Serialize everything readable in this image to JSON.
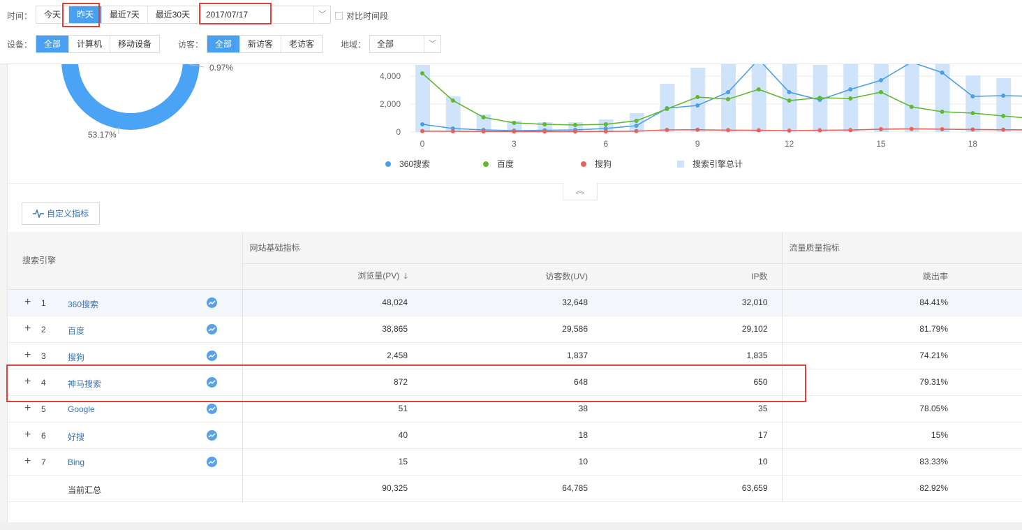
{
  "filters": {
    "time_label": "时间：",
    "time_options": [
      "今天",
      "昨天",
      "最近7天",
      "最近30天"
    ],
    "date_value": "2017/07/17",
    "compare_label": "对比时间段",
    "device_label": "设备：",
    "device_options": [
      "全部",
      "计算机",
      "移动设备"
    ],
    "visitor_label": "访客：",
    "visitor_options": [
      "全部",
      "新访客",
      "老访客"
    ],
    "region_label": "地域：",
    "region_value": "全部"
  },
  "donut": {
    "label_small": "0.97%",
    "label_big": "53.17%",
    "color": "#4aa3f5"
  },
  "chart_data": {
    "type": "bar+line",
    "x": [
      0,
      1,
      2,
      3,
      4,
      5,
      6,
      7,
      8,
      9,
      10,
      11,
      12,
      13,
      14,
      15,
      16,
      17,
      18,
      19,
      20
    ],
    "x_ticks": [
      "0",
      "3",
      "6",
      "9",
      "12",
      "15",
      "18"
    ],
    "y_ticks": [
      "0",
      "2,000",
      "4,000"
    ],
    "ylim": [
      0,
      4900
    ],
    "series": [
      {
        "name": "360搜索",
        "type": "line",
        "color": "#4a9fe6",
        "values": [
          550,
          250,
          150,
          100,
          120,
          150,
          250,
          450,
          1700,
          1900,
          2850,
          6000,
          2850,
          2300,
          3050,
          3700,
          5000,
          4250,
          2550,
          2600,
          2550
        ]
      },
      {
        "name": "百度",
        "type": "line",
        "color": "#61b82e",
        "values": [
          4200,
          2250,
          1050,
          650,
          550,
          500,
          550,
          800,
          1650,
          2500,
          2350,
          3050,
          2250,
          2450,
          2400,
          2850,
          1800,
          1450,
          1350,
          1150,
          950
        ]
      },
      {
        "name": "搜狗",
        "type": "line",
        "color": "#e8625a",
        "values": [
          60,
          50,
          40,
          30,
          30,
          30,
          40,
          60,
          150,
          160,
          130,
          120,
          100,
          120,
          140,
          200,
          220,
          200,
          180,
          160,
          150
        ]
      },
      {
        "name": "搜索引擎总计",
        "type": "bar",
        "color": "#cfe4fa",
        "values": [
          4800,
          2550,
          1250,
          800,
          700,
          700,
          900,
          1350,
          3450,
          4600,
          6000,
          6000,
          6000,
          4800,
          6000,
          6000,
          6000,
          6000,
          4050,
          3850,
          3500
        ]
      }
    ]
  },
  "legend": [
    "360搜索",
    "百度",
    "搜狗",
    "搜索引擎总计"
  ],
  "custom_button": "自定义指标",
  "table": {
    "col_engine": "搜索引擎",
    "group_basic": "网站基础指标",
    "group_quality": "流量质量指标",
    "col_pv": "浏览量(PV)",
    "col_uv": "访客数(UV)",
    "col_ip": "IP数",
    "col_bounce": "跳出率",
    "rows": [
      {
        "idx": "1",
        "name": "360搜索",
        "pv": "48,024",
        "uv": "32,648",
        "ip": "32,010",
        "bounce": "84.41%"
      },
      {
        "idx": "2",
        "name": "百度",
        "pv": "38,865",
        "uv": "29,586",
        "ip": "29,102",
        "bounce": "81.79%"
      },
      {
        "idx": "3",
        "name": "搜狗",
        "pv": "2,458",
        "uv": "1,837",
        "ip": "1,835",
        "bounce": "74.21%"
      },
      {
        "idx": "4",
        "name": "神马搜索",
        "pv": "872",
        "uv": "648",
        "ip": "650",
        "bounce": "79.31%"
      },
      {
        "idx": "5",
        "name": "Google",
        "pv": "51",
        "uv": "38",
        "ip": "35",
        "bounce": "78.05%"
      },
      {
        "idx": "6",
        "name": "好搜",
        "pv": "40",
        "uv": "18",
        "ip": "17",
        "bounce": "15%"
      },
      {
        "idx": "7",
        "name": "Bing",
        "pv": "15",
        "uv": "10",
        "ip": "10",
        "bounce": "83.33%"
      }
    ],
    "total": {
      "name": "当前汇总",
      "pv": "90,325",
      "uv": "64,785",
      "ip": "63,659",
      "bounce": "82.92%"
    }
  }
}
